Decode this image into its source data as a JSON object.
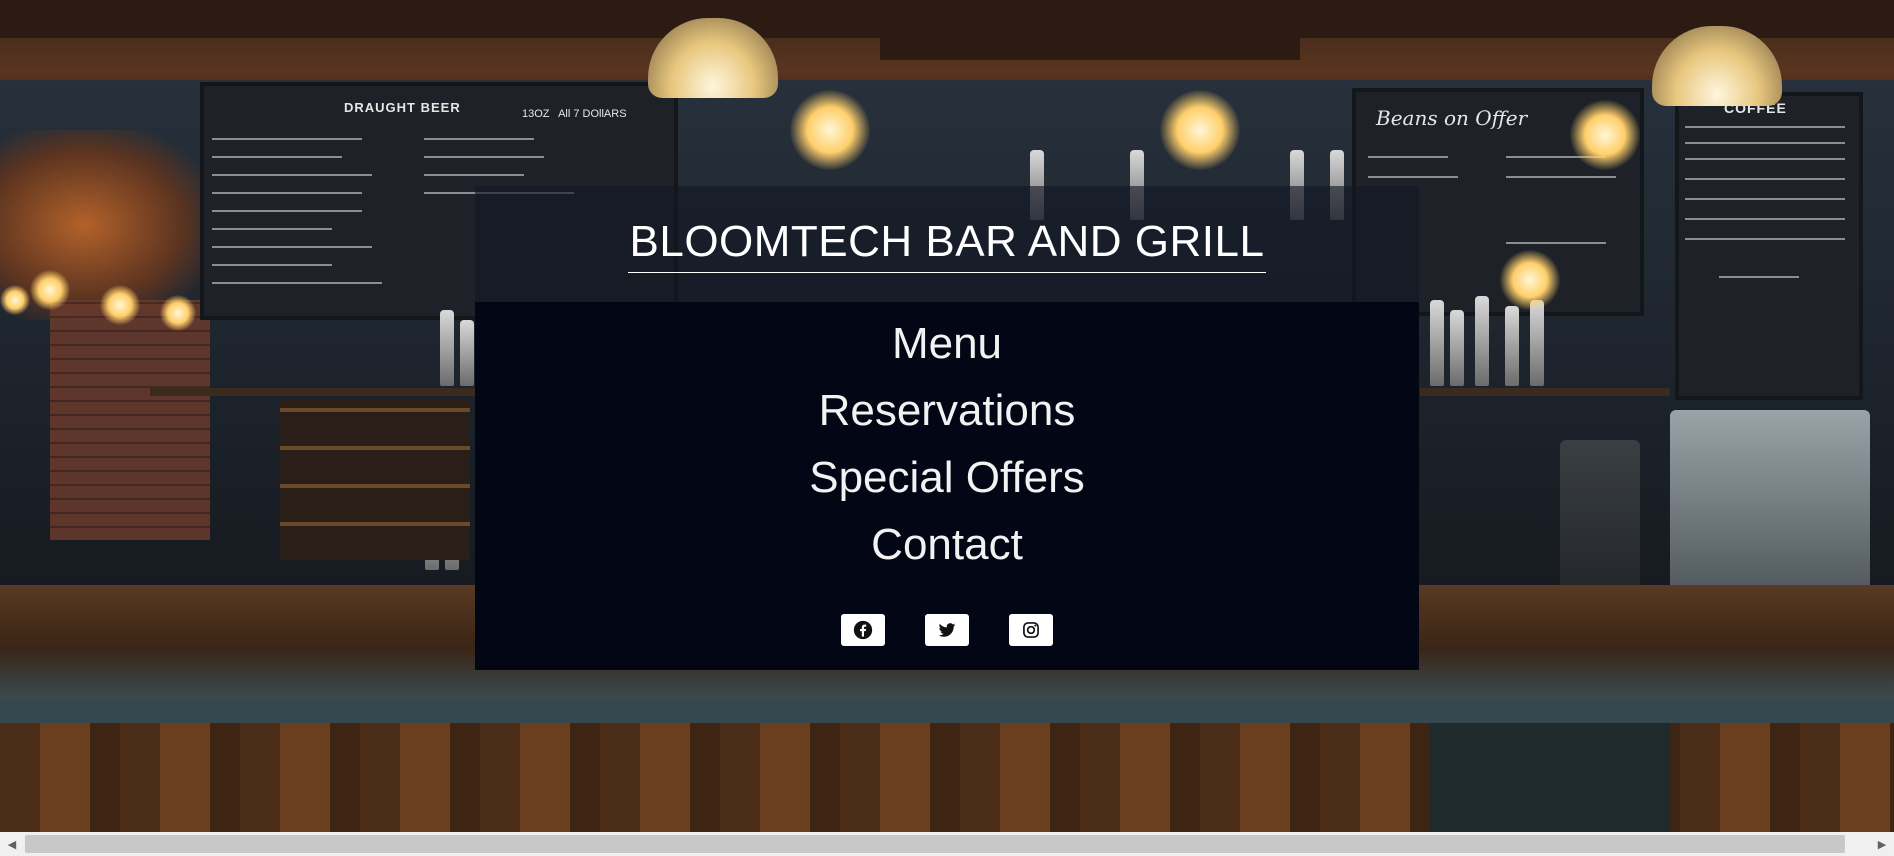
{
  "header": {
    "title": "BLOOMTECH BAR AND GRILL"
  },
  "nav": {
    "items": [
      {
        "label": "Menu"
      },
      {
        "label": "Reservations"
      },
      {
        "label": "Special Offers"
      },
      {
        "label": "Contact"
      }
    ]
  },
  "social": {
    "icons": [
      "facebook-icon",
      "twitter-icon",
      "instagram-icon"
    ]
  },
  "background": {
    "chalkboard_draught": {
      "heading": "DRAUGHT BEER",
      "sub": "13OZ   All 7 DOllARS"
    },
    "chalkboard_beans": {
      "heading": "Beans on Offer"
    },
    "chalkboard_coffee": {
      "heading": "COFFEE"
    }
  },
  "scrollbar": {
    "left_arrow": "◀",
    "right_arrow": "▶"
  },
  "colors": {
    "panel": "#030615",
    "header_band": "rgba(18,22,36,0.62)",
    "text": "#ffffff",
    "icon_button_bg": "#ffffff"
  }
}
